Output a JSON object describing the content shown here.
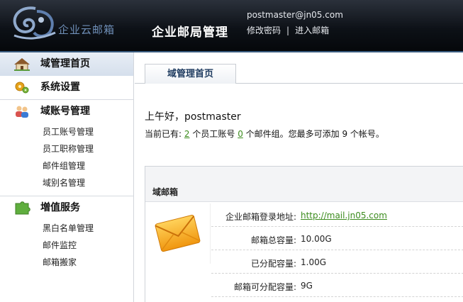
{
  "header": {
    "logo_text": "企业云邮箱",
    "title": "企业邮局管理",
    "user_email": "postmaster@jn05.com",
    "change_password": "修改密码",
    "separator": "|",
    "enter_mailbox": "进入邮箱"
  },
  "sidebar": {
    "home": "域管理首页",
    "settings": "系统设置",
    "accounts": {
      "title": "域账号管理",
      "items": [
        "员工账号管理",
        "员工职称管理",
        "邮件组管理",
        "域别名管理"
      ]
    },
    "services": {
      "title": "増值服务",
      "items": [
        "黑白名单管理",
        "邮件监控",
        "邮箱搬家"
      ]
    }
  },
  "main": {
    "tab": "域管理首页",
    "greeting": "上午好，postmaster",
    "summary": {
      "prefix": "当前已有:",
      "staff_count": "2",
      "staff_label": "个员工账号",
      "group_count": "0",
      "suffix": "个邮件组。您最多可添加 9 个帐号。"
    },
    "mailbox": {
      "title": "域邮箱",
      "rows": [
        {
          "label": "企业邮箱登录地址:",
          "value": "http://mail.jn05.com"
        },
        {
          "label": "邮箱总容量:",
          "value": "10.00G"
        },
        {
          "label": "已分配容量:",
          "value": "1.00G"
        },
        {
          "label": "邮箱可分配容量:",
          "value": "9G"
        }
      ]
    }
  },
  "colors": {
    "header_bg": "#0d1117",
    "link_green": "#3c8c1e",
    "tab_text": "#1d3a5f",
    "sidebar_active": "#d5dfec"
  }
}
